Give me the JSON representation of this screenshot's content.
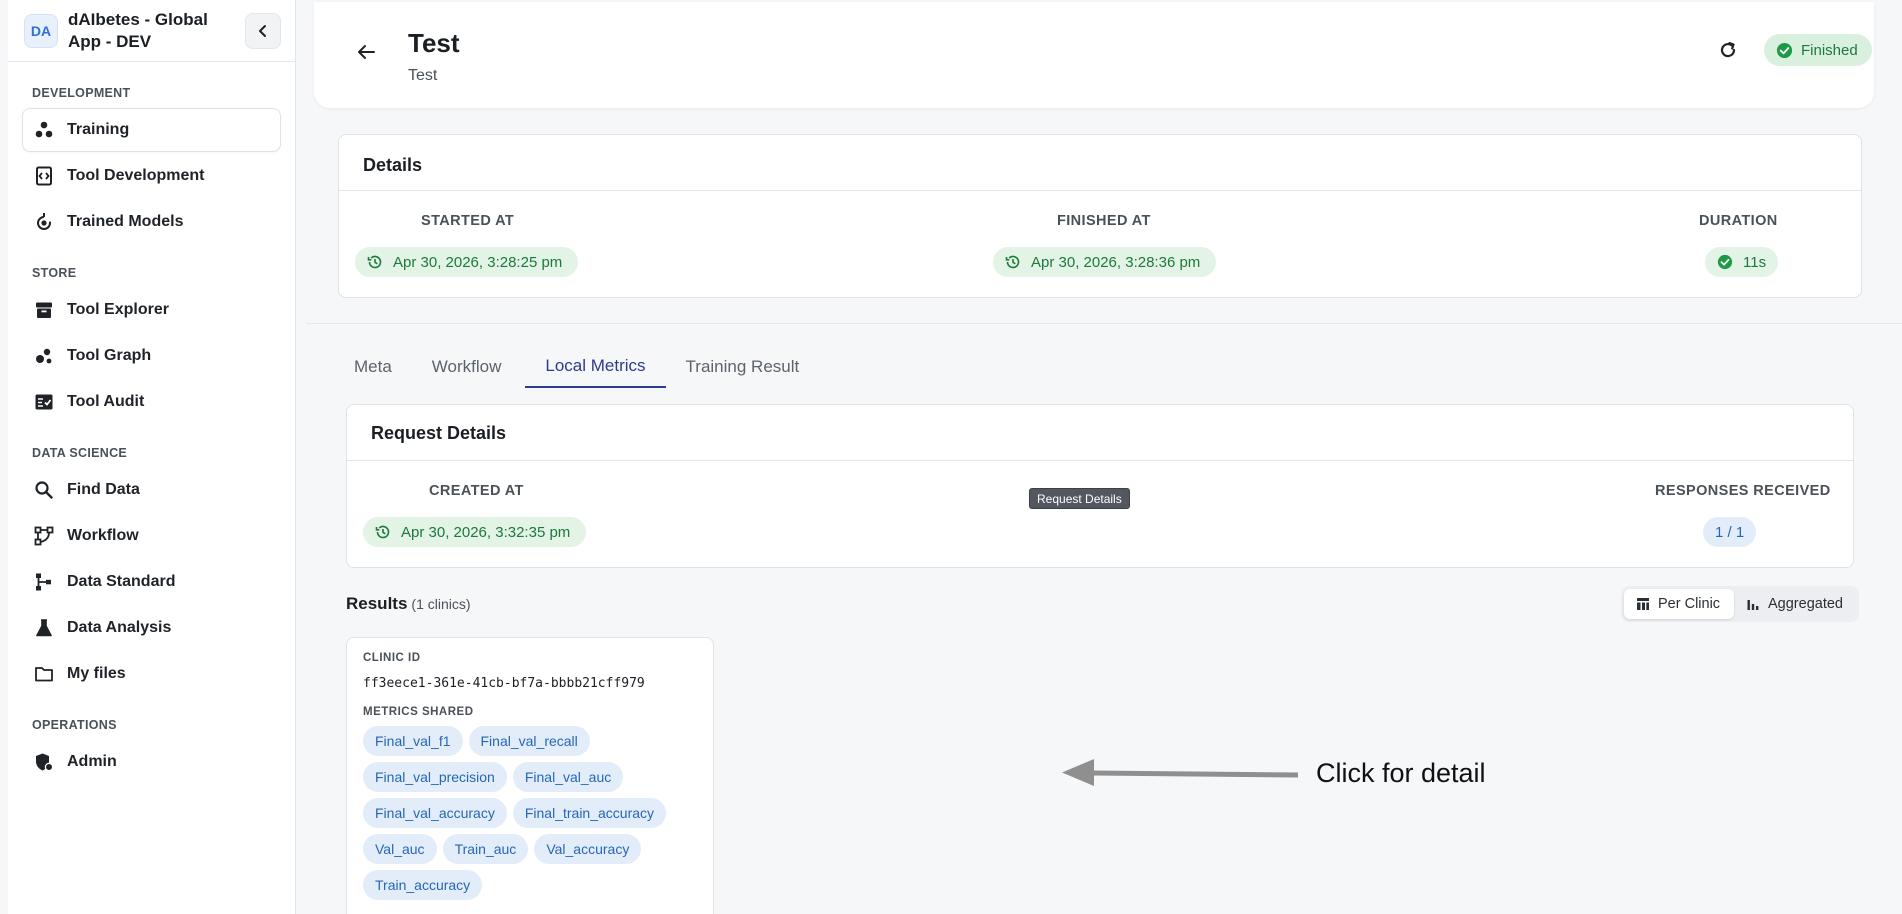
{
  "app": {
    "avatar": "DA",
    "name": "dAIbetes - Global App - DEV"
  },
  "sidebar": {
    "sections": [
      {
        "label": "DEVELOPMENT",
        "items": [
          {
            "label": "Training",
            "icon": "training-icon",
            "active": true
          },
          {
            "label": "Tool Development",
            "icon": "code-file-icon"
          },
          {
            "label": "Trained Models",
            "icon": "model-icon"
          }
        ]
      },
      {
        "label": "STORE",
        "items": [
          {
            "label": "Tool Explorer",
            "icon": "archive-icon"
          },
          {
            "label": "Tool Graph",
            "icon": "graph-icon"
          },
          {
            "label": "Tool Audit",
            "icon": "audit-icon"
          }
        ]
      },
      {
        "label": "DATA SCIENCE",
        "items": [
          {
            "label": "Find Data",
            "icon": "search-icon"
          },
          {
            "label": "Workflow",
            "icon": "workflow-icon"
          },
          {
            "label": "Data Standard",
            "icon": "hierarchy-icon"
          },
          {
            "label": "Data Analysis",
            "icon": "flask-icon"
          },
          {
            "label": "My files",
            "icon": "folder-icon"
          }
        ]
      },
      {
        "label": "OPERATIONS",
        "items": [
          {
            "label": "Admin",
            "icon": "admin-shield-icon"
          }
        ]
      }
    ]
  },
  "header": {
    "title": "Test",
    "subtitle": "Test",
    "status": "Finished"
  },
  "details": {
    "title": "Details",
    "started_label": "STARTED AT",
    "started_value": "Apr 30, 2026, 3:28:25 pm",
    "finished_label": "FINISHED AT",
    "finished_value": "Apr 30, 2026, 3:28:36 pm",
    "duration_label": "DURATION",
    "duration_value": "11s"
  },
  "tabs": [
    {
      "label": "Meta"
    },
    {
      "label": "Workflow"
    },
    {
      "label": "Local Metrics",
      "active": true
    },
    {
      "label": "Training Result"
    }
  ],
  "request": {
    "title": "Request Details",
    "created_label": "CREATED AT",
    "created_value": "Apr 30, 2026, 3:32:35 pm",
    "responses_label": "RESPONSES RECEIVED",
    "responses_value": "1 / 1",
    "tooltip": "Request Details"
  },
  "results": {
    "title": "Results",
    "count": "(1 clinics)",
    "view_per_clinic": "Per Clinic",
    "view_aggregated": "Aggregated",
    "clinic_id_label": "CLINIC ID",
    "clinic_id": "ff3eece1-361e-41cb-bf7a-bbbb21cff979",
    "metrics_label": "METRICS SHARED",
    "metrics": [
      "Final_val_f1",
      "Final_val_recall",
      "Final_val_precision",
      "Final_val_auc",
      "Final_val_accuracy",
      "Final_train_accuracy",
      "Val_auc",
      "Train_auc",
      "Val_accuracy",
      "Train_accuracy"
    ]
  },
  "annotation": {
    "text": "Click for detail"
  },
  "colors": {
    "accent": "#2b3b8f",
    "success_bg": "#d9f0df",
    "success_fg": "#1c7a3b",
    "chip_bg": "#e2edf9",
    "chip_fg": "#2566b8"
  }
}
